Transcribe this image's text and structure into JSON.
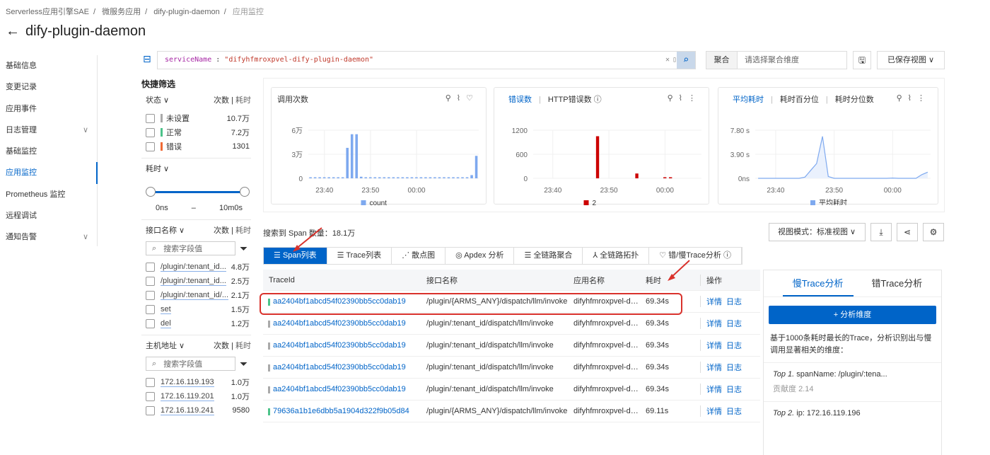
{
  "breadcrumb": [
    "Serverless应用引擎SAE",
    "微服务应用",
    "dify-plugin-daemon",
    "应用监控"
  ],
  "page_title": "dify-plugin-daemon",
  "nav": [
    {
      "label": "基础信息"
    },
    {
      "label": "变更记录"
    },
    {
      "label": "应用事件"
    },
    {
      "label": "日志管理",
      "chevron": true
    },
    {
      "label": "基础监控"
    },
    {
      "label": "应用监控",
      "active": true
    },
    {
      "label": "Prometheus 监控"
    },
    {
      "label": "远程调试"
    },
    {
      "label": "通知告警",
      "chevron": true
    }
  ],
  "query": {
    "key": "serviceName",
    "op": " : ",
    "value": "\"difyhfmroxpvel-dify-plugin-daemon\"",
    "agg_label": "聚合",
    "agg_placeholder": "请选择聚合维度",
    "saved_view": "已保存视图"
  },
  "filter": {
    "title": "快捷筛选",
    "count_label": "次数",
    "time_label": "耗时",
    "status": {
      "title": "状态",
      "items": [
        {
          "label": "未设置",
          "count": "10.7万",
          "color": "#aaaaaa"
        },
        {
          "label": "正常",
          "count": "7.2万",
          "color": "#4cc38a"
        },
        {
          "label": "错误",
          "count": "1301",
          "color": "#f06a35"
        }
      ]
    },
    "duration": {
      "title": "耗时",
      "min": "0ns",
      "dash": "–",
      "max": "10m0s"
    },
    "api": {
      "title": "接口名称",
      "placeholder": "搜索字段值",
      "items": [
        {
          "label": "/plugin/:tenant_id...",
          "count": "4.8万"
        },
        {
          "label": "/plugin/:tenant_id...",
          "count": "2.5万"
        },
        {
          "label": "/plugin/:tenant_id/...",
          "count": "2.1万"
        },
        {
          "label": "set",
          "count": "1.5万"
        },
        {
          "label": "del",
          "count": "1.2万"
        }
      ]
    },
    "host": {
      "title": "主机地址",
      "placeholder": "搜索字段值",
      "items": [
        {
          "label": "172.16.119.193",
          "count": "1.0万"
        },
        {
          "label": "172.16.119.201",
          "count": "1.0万"
        },
        {
          "label": "172.16.119.241",
          "count": "9580"
        }
      ]
    }
  },
  "charts": {
    "calls_title": "调用次数",
    "err_tabs": [
      "错误数",
      "HTTP错误数"
    ],
    "lat_tabs": [
      "平均耗时",
      "耗时百分位",
      "耗时分位数"
    ]
  },
  "chart_data": [
    {
      "type": "bar",
      "title": "调用次数",
      "x": [
        "23:37",
        "23:38",
        "23:39",
        "23:40",
        "23:41",
        "23:42",
        "23:43",
        "23:44",
        "23:45",
        "23:46",
        "23:47",
        "23:48",
        "23:49",
        "23:50",
        "23:51",
        "23:52",
        "23:53",
        "23:54",
        "23:55",
        "23:56",
        "23:57",
        "23:58",
        "23:59",
        "00:00",
        "00:01",
        "00:02",
        "00:03",
        "00:04",
        "00:05",
        "00:06",
        "00:07",
        "00:08",
        "00:09",
        "00:10",
        "00:11",
        "00:12",
        "00:13"
      ],
      "series": [
        {
          "name": "count",
          "color": "#7ea9ef",
          "values": [
            500,
            500,
            500,
            500,
            500,
            500,
            500,
            800,
            38000,
            55000,
            55000,
            2000,
            500,
            500,
            500,
            500,
            500,
            500,
            500,
            500,
            500,
            500,
            500,
            500,
            500,
            500,
            500,
            500,
            500,
            500,
            500,
            500,
            500,
            1200,
            500,
            4000,
            28000
          ]
        }
      ],
      "yticks": [
        "0",
        "3万",
        "6万"
      ],
      "ylim": [
        0,
        60000
      ],
      "xticks": [
        "23:40",
        "23:50",
        "00:00"
      ]
    },
    {
      "type": "bar",
      "title": "错误数",
      "x": [
        "23:37",
        "23:38",
        "23:39",
        "23:40",
        "23:41",
        "23:42",
        "23:43",
        "23:44",
        "23:45",
        "23:46",
        "23:47",
        "23:48",
        "23:49",
        "23:50",
        "23:51",
        "23:52",
        "23:53",
        "23:54",
        "23:55",
        "23:56",
        "23:57",
        "23:58",
        "23:59",
        "00:00",
        "00:01",
        "00:02",
        "00:03",
        "00:04",
        "00:05",
        "00:06"
      ],
      "series": [
        {
          "name": "2",
          "color": "#cc0000",
          "values": [
            0,
            0,
            0,
            0,
            0,
            0,
            0,
            0,
            0,
            0,
            0,
            1050,
            0,
            0,
            0,
            0,
            0,
            0,
            120,
            0,
            0,
            0,
            0,
            10,
            10,
            0,
            0,
            0,
            0,
            0
          ]
        }
      ],
      "yticks": [
        "0",
        "600",
        "1200"
      ],
      "ylim": [
        0,
        1200
      ],
      "xticks": [
        "23:40",
        "23:50",
        "00:00"
      ]
    },
    {
      "type": "area",
      "title": "平均耗时",
      "x": [
        "23:37",
        "23:38",
        "23:39",
        "23:40",
        "23:41",
        "23:42",
        "23:43",
        "23:44",
        "23:45",
        "23:46",
        "23:47",
        "23:48",
        "23:49",
        "23:50",
        "23:51",
        "23:52",
        "23:53",
        "23:54",
        "23:55",
        "23:56",
        "23:57",
        "23:58",
        "23:59",
        "00:00",
        "00:01",
        "00:02",
        "00:03",
        "00:04",
        "00:05",
        "00:06"
      ],
      "series": [
        {
          "name": "平均耗时",
          "color": "#7ea9ef",
          "values": [
            0,
            0,
            0,
            0,
            0,
            0,
            0,
            0,
            0.2,
            1.3,
            2.4,
            6.8,
            0.3,
            0,
            0,
            0,
            0,
            0,
            0,
            0,
            0,
            0,
            0,
            0.05,
            0,
            0,
            0,
            0,
            0.6,
            1.0
          ]
        }
      ],
      "yticks": [
        "0ns",
        "3.90 s",
        "7.80 s"
      ],
      "ylim": [
        0,
        7.8
      ],
      "xticks": [
        "23:40",
        "23:50",
        "00:00"
      ]
    }
  ],
  "span_count_label": "搜索到 Span 数量：",
  "span_count": "18.1万",
  "view_mode": "视图模式：标准视图",
  "tabs": [
    "Span列表",
    "Trace列表",
    "散点图",
    "Apdex 分析",
    "全链路聚合",
    "全链路拓扑",
    "错/慢Trace分析"
  ],
  "table": {
    "headers": [
      "TraceId",
      "接口名称",
      "应用名称",
      "耗时",
      "操作"
    ],
    "detail": "详情",
    "log": "日志",
    "rows": [
      {
        "id": "aa2404bf1abcd54f02390bb5cc0dab19",
        "api": "/plugin/{ARMS_ANY}/dispatch/llm/invoke",
        "app": "difyhfmroxpvel-dify-plugin-daemon",
        "dur": "69.34s",
        "color": "#4cc38a"
      },
      {
        "id": "aa2404bf1abcd54f02390bb5cc0dab19",
        "api": "/plugin/:tenant_id/dispatch/llm/invoke",
        "app": "difyhfmroxpvel-dify-plugin-daemon",
        "dur": "69.34s",
        "color": "#aaaaaa"
      },
      {
        "id": "aa2404bf1abcd54f02390bb5cc0dab19",
        "api": "/plugin/:tenant_id/dispatch/llm/invoke",
        "app": "difyhfmroxpvel-dify-plugin-daemon",
        "dur": "69.34s",
        "color": "#aaaaaa"
      },
      {
        "id": "aa2404bf1abcd54f02390bb5cc0dab19",
        "api": "/plugin/:tenant_id/dispatch/llm/invoke",
        "app": "difyhfmroxpvel-dify-plugin-daemon",
        "dur": "69.34s",
        "color": "#aaaaaa"
      },
      {
        "id": "aa2404bf1abcd54f02390bb5cc0dab19",
        "api": "/plugin/:tenant_id/dispatch/llm/invoke",
        "app": "difyhfmroxpvel-dify-plugin-daemon",
        "dur": "69.34s",
        "color": "#aaaaaa"
      },
      {
        "id": "79636a1b1e6dbb5a1904d322f9b05d84",
        "api": "/plugin/{ARMS_ANY}/dispatch/llm/invoke",
        "app": "difyhfmroxpvel-dify-plugin-daemon",
        "dur": "69.11s",
        "color": "#4cc38a"
      }
    ]
  },
  "analysis": {
    "tabs": [
      "慢Trace分析",
      "错Trace分析"
    ],
    "button": "+ 分析维度",
    "desc": "基于1000条耗时最长的Trace，分析识别出与慢调用显著相关的维度：",
    "items": [
      {
        "rank": "Top 1.",
        "text": "spanName: /plugin/:tena...",
        "score_label": "贡献度",
        "score": "2.14"
      },
      {
        "rank": "Top 2.",
        "text": "ip: 172.16.119.196"
      }
    ]
  }
}
